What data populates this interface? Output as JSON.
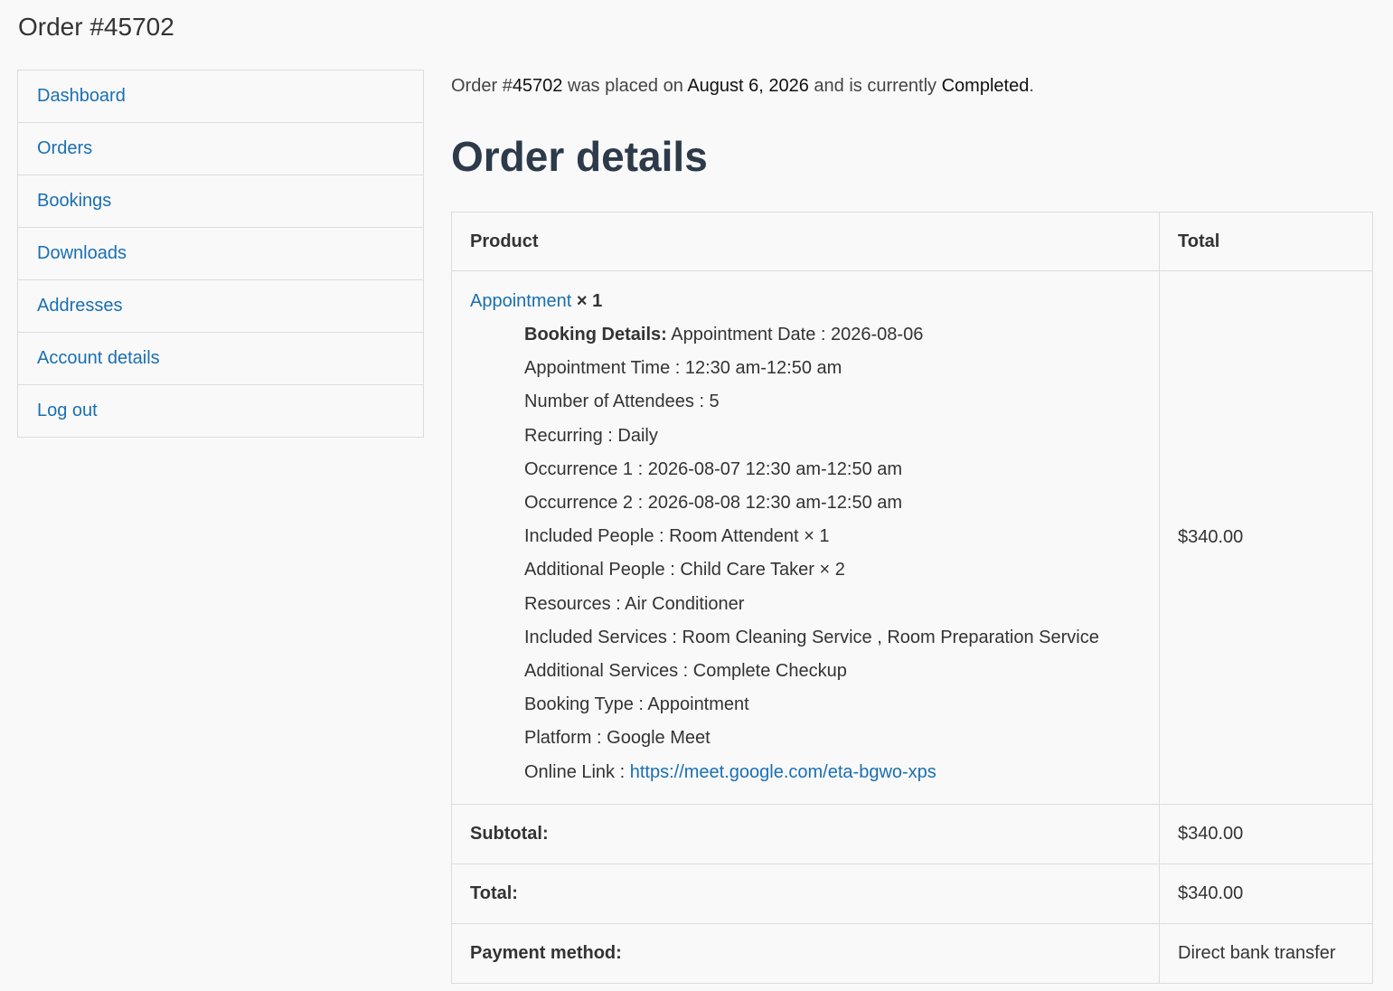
{
  "page": {
    "title": "Order #45702"
  },
  "sidebar": {
    "items": [
      {
        "label": "Dashboard"
      },
      {
        "label": "Orders"
      },
      {
        "label": "Bookings"
      },
      {
        "label": "Downloads"
      },
      {
        "label": "Addresses"
      },
      {
        "label": "Account details"
      },
      {
        "label": "Log out"
      }
    ]
  },
  "order": {
    "intro_prefix": "Order #",
    "number": "45702",
    "intro_mid1": " was placed on ",
    "date": "August 6, 2026",
    "intro_mid2": " and is currently ",
    "status": "Completed",
    "intro_suffix": "."
  },
  "details": {
    "heading": "Order details",
    "columns": {
      "product": "Product",
      "total": "Total"
    },
    "item": {
      "name": "Appointment",
      "qty": "× 1",
      "total": "$340.00",
      "meta": [
        {
          "key": "Booking Details:",
          "value": " Appointment Date : 2026-08-06"
        },
        {
          "key": "Appointment Time",
          "value": " : 12:30 am-12:50 am"
        },
        {
          "key": "Number of Attendees",
          "value": " : 5"
        },
        {
          "key": "Recurring",
          "value": " : Daily"
        },
        {
          "key": "Occurrence 1",
          "value": " : 2026-08-07 12:30 am-12:50 am"
        },
        {
          "key": "Occurrence 2",
          "value": " : 2026-08-08 12:30 am-12:50 am"
        },
        {
          "key": "Included People",
          "value": " : Room Attendent × 1"
        },
        {
          "key": "Additional People",
          "value": " : Child Care Taker × 2"
        },
        {
          "key": "Resources",
          "value": " : Air Conditioner"
        },
        {
          "key": "Included Services",
          "value": " : Room Cleaning Service , Room Preparation Service"
        },
        {
          "key": "Additional Services",
          "value": " : Complete Checkup"
        },
        {
          "key": "Booking Type",
          "value": " : Appointment"
        },
        {
          "key": "Platform",
          "value": " : Google Meet"
        },
        {
          "key": "Online Link",
          "value": " : "
        }
      ],
      "online_link": "https://meet.google.com/eta-bgwo-xps"
    },
    "footer": [
      {
        "label": "Subtotal:",
        "value": "$340.00"
      },
      {
        "label": "Total:",
        "value": "$340.00"
      },
      {
        "label": "Payment method:",
        "value": "Direct bank transfer"
      }
    ]
  }
}
